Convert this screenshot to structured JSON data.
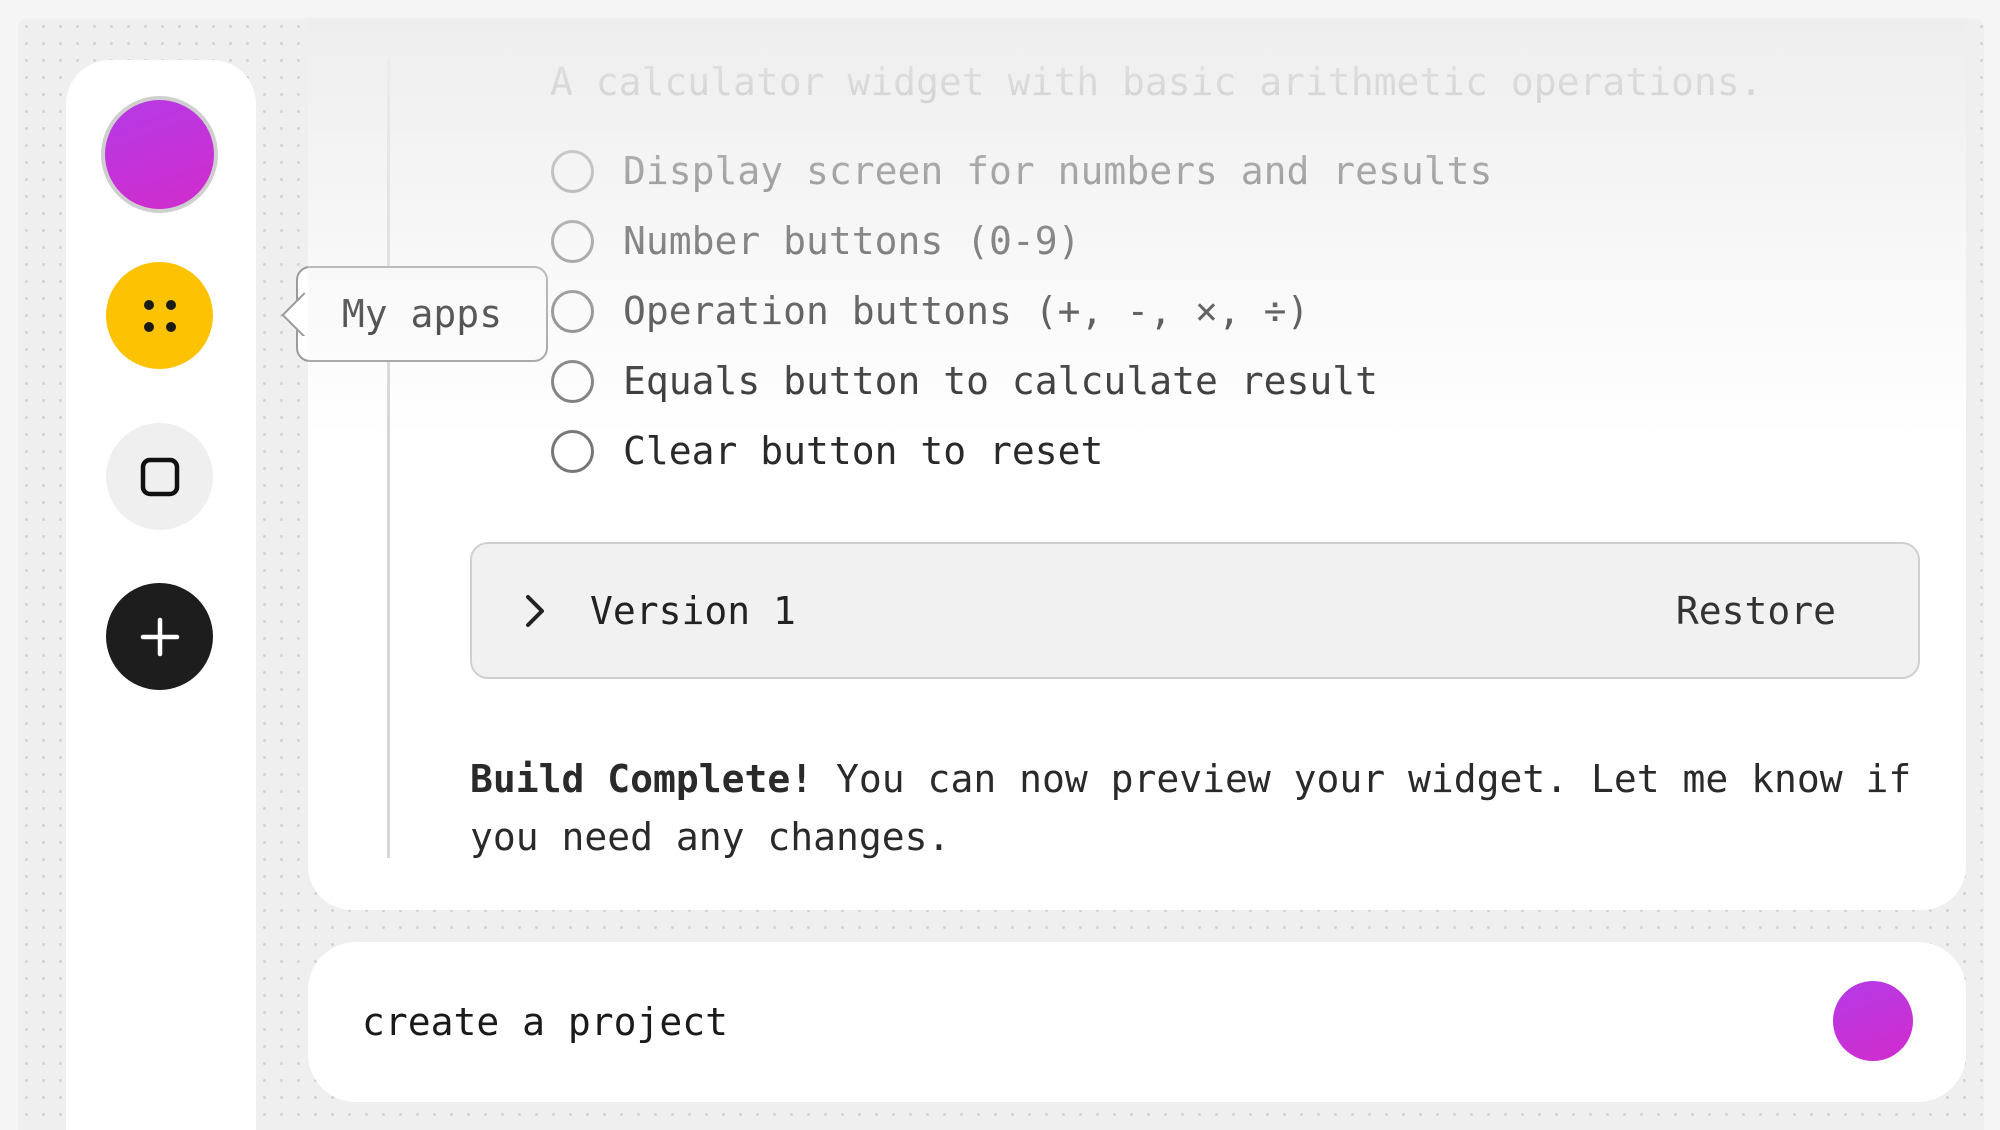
{
  "sidebar": {
    "avatar_color": "#c62fd8",
    "apps_icon": "dots-grid-icon",
    "apps_color": "#fdc202",
    "window_icon": "square-icon",
    "add_icon": "plus-icon",
    "add_color": "#1d1d1d"
  },
  "tooltip": {
    "label": "My apps"
  },
  "thread": {
    "description": "A calculator widget with basic arithmetic operations.",
    "checklist": [
      {
        "label": "Display screen for numbers and results",
        "checked": false
      },
      {
        "label": "Number buttons (0-9)",
        "checked": false
      },
      {
        "label": "Operation buttons (+, -, ×, ÷)",
        "checked": false
      },
      {
        "label": "Equals button to calculate result",
        "checked": false
      },
      {
        "label": "Clear button to reset",
        "checked": false
      }
    ],
    "version": {
      "label": "Version 1",
      "restore_label": "Restore",
      "expand_icon": "chevron-right-icon"
    },
    "final_message": {
      "bold": "Build Complete!",
      "text": " You can now preview your widget. Let me know if you need any changes."
    }
  },
  "composer": {
    "value": "create a project",
    "send_color": "#c62fd8"
  }
}
